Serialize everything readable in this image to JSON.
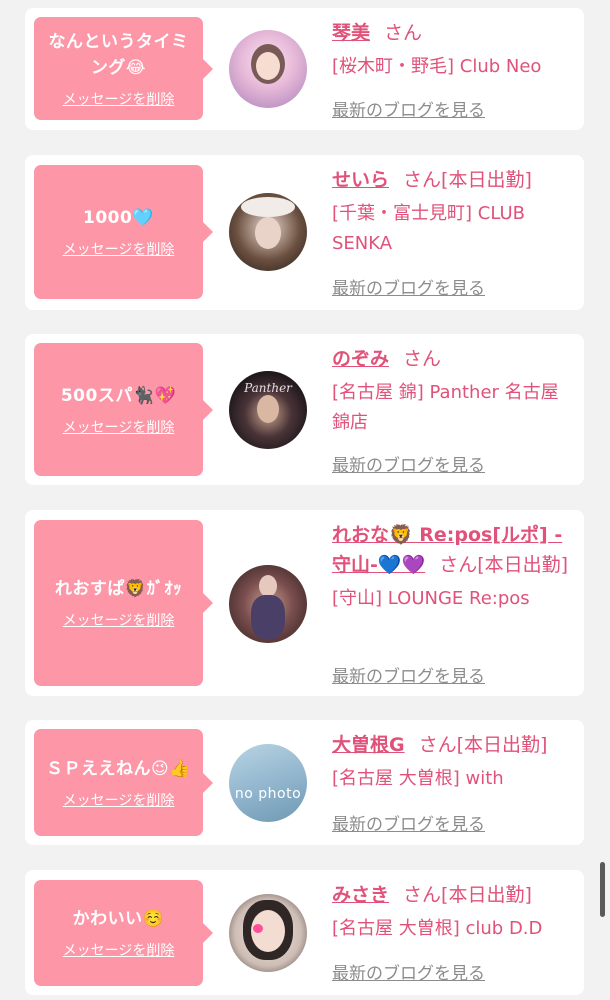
{
  "cards": [
    {
      "message": "なんというタイミング😂",
      "delete_label": "メッセージを削除",
      "name": "琴美",
      "honorific": "さん",
      "status": "",
      "shop": "[桜木町・野毛] Club Neo",
      "blog_label": "最新のブログを見る"
    },
    {
      "message": "1000🩵",
      "delete_label": "メッセージを削除",
      "name": "せいら",
      "honorific": "さん",
      "status": "[本日出勤]",
      "shop": "[千葉・富士見町] CLUB SENKA",
      "blog_label": "最新のブログを見る"
    },
    {
      "message": "500スパ🐈‍⬛💖",
      "delete_label": "メッセージを削除",
      "name": "のぞみ",
      "honorific": "さん",
      "status": "",
      "shop": "[名古屋 錦] Panther 名古屋錦店",
      "blog_label": "最新のブログを見る",
      "avatar_text": "Panther"
    },
    {
      "message": "れおすぱ🦁ｶﾞｵｯ",
      "delete_label": "メッセージを削除",
      "name": "れおな🦁 Re:pos[ルポ] -守山-💙💜",
      "honorific": "さん",
      "status": "[本日出勤]",
      "shop": "[守山] LOUNGE Re:pos",
      "blog_label": "最新のブログを見る"
    },
    {
      "message": "ＳＰええねん😉👍",
      "delete_label": "メッセージを削除",
      "name": "大曽根G",
      "honorific": "さん",
      "status": "[本日出勤]",
      "shop": "[名古屋 大曽根] with",
      "blog_label": "最新のブログを見る",
      "avatar_text": "no photo"
    },
    {
      "message": "かわいい☺️",
      "delete_label": "メッセージを削除",
      "name": "みさき",
      "honorific": "さん",
      "status": "[本日出勤]",
      "shop": "[名古屋 大曽根] club D.D",
      "blog_label": "最新のブログを見る"
    }
  ]
}
